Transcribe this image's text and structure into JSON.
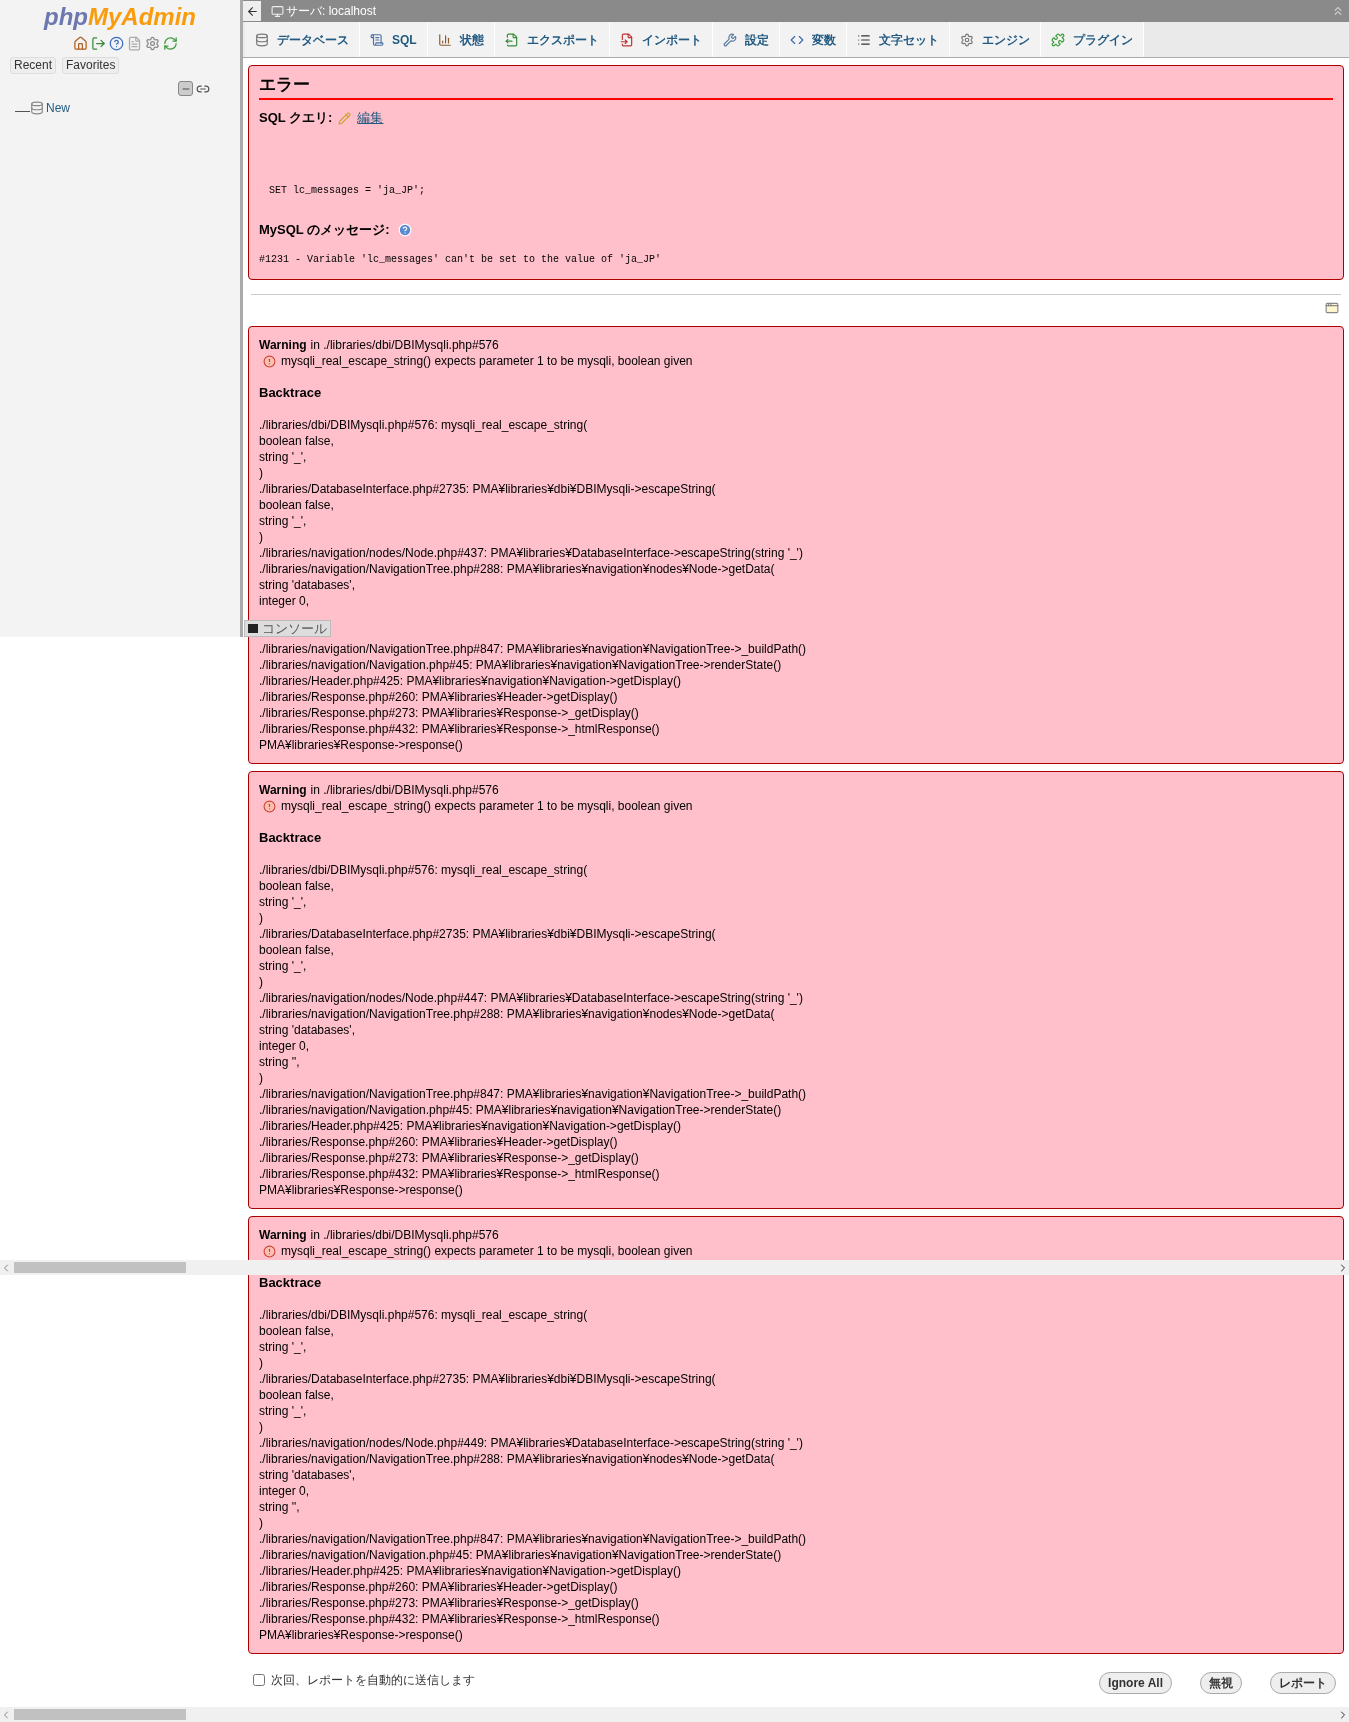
{
  "sidebar": {
    "logo": [
      "php",
      "MyAdmin"
    ],
    "buttons": [
      "Recent",
      "Favorites"
    ],
    "tree": [
      {
        "label": "New"
      }
    ]
  },
  "top_bar": {
    "title": "サーバ: localhost"
  },
  "tabs": [
    {
      "label": "データベース"
    },
    {
      "label": "SQL"
    },
    {
      "label": "状態"
    },
    {
      "label": "エクスポート"
    },
    {
      "label": "インポート"
    },
    {
      "label": "設定"
    },
    {
      "label": "変数"
    },
    {
      "label": "文字セット"
    },
    {
      "label": "エンジン"
    },
    {
      "label": "プラグイン"
    }
  ],
  "error": {
    "title": "エラー",
    "query_label": "SQL クエリ:",
    "edit_link": "編集",
    "query": "SET lc_messages = 'ja_JP';",
    "message_label": "MySQL のメッセージ:",
    "message": "#1231 - Variable 'lc_messages' can't be set to the value of 'ja_JP'"
  },
  "warnings": [
    {
      "label": "Warning",
      "location": "in ./libraries/dbi/DBIMysqli.php#576",
      "message": "mysqli_real_escape_string() expects parameter 1 to be mysqli, boolean given",
      "heading": "Backtrace",
      "lines": [
        "./libraries/dbi/DBIMysqli.php#576: mysqli_real_escape_string(",
        "boolean false,",
        "string '_',",
        ")",
        "./libraries/DatabaseInterface.php#2735: PMA¥libraries¥dbi¥DBIMysqli->escapeString(",
        "boolean false,",
        "string '_',",
        ")",
        "./libraries/navigation/nodes/Node.php#437: PMA¥libraries¥DatabaseInterface->escapeString(string '_')",
        "./libraries/navigation/NavigationTree.php#288: PMA¥libraries¥navigation¥nodes¥Node->getData(",
        "string 'databases',",
        "integer 0,"
      ],
      "lines_after_console": [
        "./libraries/navigation/NavigationTree.php#847: PMA¥libraries¥navigation¥NavigationTree->_buildPath()",
        "./libraries/navigation/Navigation.php#45: PMA¥libraries¥navigation¥NavigationTree->renderState()",
        "./libraries/Header.php#425: PMA¥libraries¥navigation¥Navigation->getDisplay()",
        "./libraries/Response.php#260: PMA¥libraries¥Header->getDisplay()",
        "./libraries/Response.php#273: PMA¥libraries¥Response->_getDisplay()",
        "./libraries/Response.php#432: PMA¥libraries¥Response->_htmlResponse()",
        "PMA¥libraries¥Response->response()"
      ]
    },
    {
      "label": "Warning",
      "location": "in ./libraries/dbi/DBIMysqli.php#576",
      "message": "mysqli_real_escape_string() expects parameter 1 to be mysqli, boolean given",
      "heading": "Backtrace",
      "lines": [
        "./libraries/dbi/DBIMysqli.php#576: mysqli_real_escape_string(",
        "boolean false,",
        "string '_',",
        ")",
        "./libraries/DatabaseInterface.php#2735: PMA¥libraries¥dbi¥DBIMysqli->escapeString(",
        "boolean false,",
        "string '_',",
        ")",
        "./libraries/navigation/nodes/Node.php#447: PMA¥libraries¥DatabaseInterface->escapeString(string '_')",
        "./libraries/navigation/NavigationTree.php#288: PMA¥libraries¥navigation¥nodes¥Node->getData(",
        "string 'databases',",
        "integer 0,",
        "string '',",
        ")",
        "./libraries/navigation/NavigationTree.php#847: PMA¥libraries¥navigation¥NavigationTree->_buildPath()",
        "./libraries/navigation/Navigation.php#45: PMA¥libraries¥navigation¥NavigationTree->renderState()",
        "./libraries/Header.php#425: PMA¥libraries¥navigation¥Navigation->getDisplay()",
        "./libraries/Response.php#260: PMA¥libraries¥Header->getDisplay()",
        "./libraries/Response.php#273: PMA¥libraries¥Response->_getDisplay()",
        "./libraries/Response.php#432: PMA¥libraries¥Response->_htmlResponse()",
        "PMA¥libraries¥Response->response()"
      ]
    },
    {
      "label": "Warning",
      "location": "in ./libraries/dbi/DBIMysqli.php#576",
      "message": "mysqli_real_escape_string() expects parameter 1 to be mysqli, boolean given",
      "heading": "Backtrace",
      "lines": [
        "./libraries/dbi/DBIMysqli.php#576: mysqli_real_escape_string(",
        "boolean false,",
        "string '_',",
        ")",
        "./libraries/DatabaseInterface.php#2735: PMA¥libraries¥dbi¥DBIMysqli->escapeString(",
        "boolean false,",
        "string '_',",
        ")",
        "./libraries/navigation/nodes/Node.php#449: PMA¥libraries¥DatabaseInterface->escapeString(string '_')",
        "./libraries/navigation/NavigationTree.php#288: PMA¥libraries¥navigation¥nodes¥Node->getData(",
        "string 'databases',",
        "integer 0,",
        "string '',",
        ")",
        "./libraries/navigation/NavigationTree.php#847: PMA¥libraries¥navigation¥NavigationTree->_buildPath()",
        "./libraries/navigation/Navigation.php#45: PMA¥libraries¥navigation¥NavigationTree->renderState()",
        "./libraries/Header.php#425: PMA¥libraries¥navigation¥Navigation->getDisplay()",
        "./libraries/Response.php#260: PMA¥libraries¥Header->getDisplay()",
        "./libraries/Response.php#273: PMA¥libraries¥Response->_getDisplay()",
        "./libraries/Response.php#432: PMA¥libraries¥Response->_htmlResponse()",
        "PMA¥libraries¥Response->response()"
      ]
    }
  ],
  "report": {
    "auto_send": {
      "label": "次回、レポートを自動的に送信します",
      "checked": false
    },
    "buttons": [
      "Ignore All",
      "無視",
      "レポート"
    ]
  },
  "console": {
    "label": "コンソール"
  }
}
